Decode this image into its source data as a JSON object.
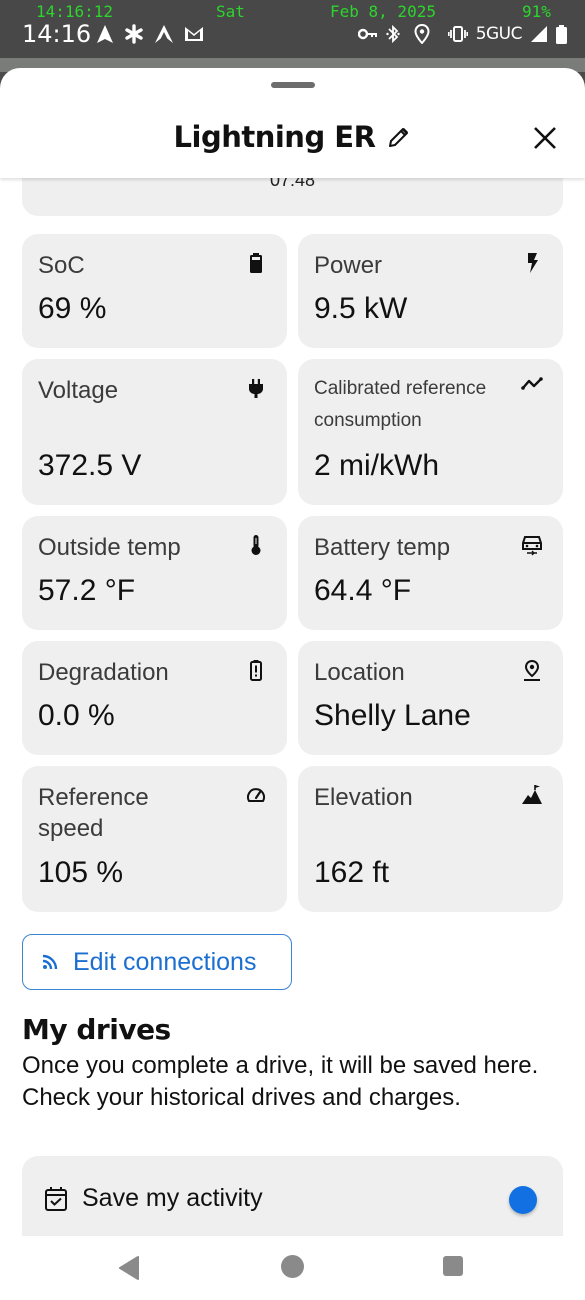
{
  "status_bar": {
    "debug_time": "14:16:12",
    "debug_day": "Sat",
    "debug_date": "Feb 8, 2025",
    "debug_battery": "91%",
    "clock": "14:16",
    "network": "5GUC",
    "left_icons": [
      "navigation-icon",
      "asterisk-icon",
      "android-auto-icon",
      "gmail-icon"
    ],
    "right_icons": [
      "vpn-key-icon",
      "bluetooth-icon",
      "location-icon",
      "vibrate-icon",
      "signal-icon",
      "battery-icon"
    ]
  },
  "header": {
    "title": "Lightning ER",
    "edit_icon": "pencil-icon",
    "close_icon": "close-icon"
  },
  "previous_card": {
    "clipped_text": "07:48"
  },
  "metrics": [
    {
      "label": "SoC",
      "value": "69 %",
      "icon": "battery-full-icon"
    },
    {
      "label": "Power",
      "value": "9.5 kW",
      "icon": "lightning-bolt-icon"
    },
    {
      "label": "Voltage",
      "value": "372.5 V",
      "icon": "plug-icon"
    },
    {
      "label": "Calibrated reference consumption",
      "value": "2 mi/kWh",
      "icon": "trend-line-icon"
    },
    {
      "label": "Outside temp",
      "value": "57.2 °F",
      "icon": "thermometer-icon"
    },
    {
      "label": "Battery temp",
      "value": "64.4 °F",
      "icon": "car-heat-icon"
    },
    {
      "label": "Degradation",
      "value": "0.0 %",
      "icon": "battery-alert-icon"
    },
    {
      "label": "Location",
      "value": "Shelly Lane",
      "icon": "map-pin-icon"
    },
    {
      "label": "Reference speed",
      "value": "105 %",
      "icon": "speedometer-icon"
    },
    {
      "label": "Elevation",
      "value": "162 ft",
      "icon": "mountain-flag-icon"
    }
  ],
  "edit_connections": {
    "label": "Edit connections",
    "icon": "rss-feed-icon",
    "color": "#1c6fd1"
  },
  "my_drives": {
    "title": "My drives",
    "description": "Once you complete a drive, it will be saved here. Check your historical drives and charges."
  },
  "save_activity": {
    "label": "Save my activity",
    "icon": "calendar-check-icon",
    "enabled": true,
    "toggle_color": "#1270e3"
  },
  "nav_bar": {
    "buttons": [
      "back",
      "home",
      "recents"
    ]
  }
}
